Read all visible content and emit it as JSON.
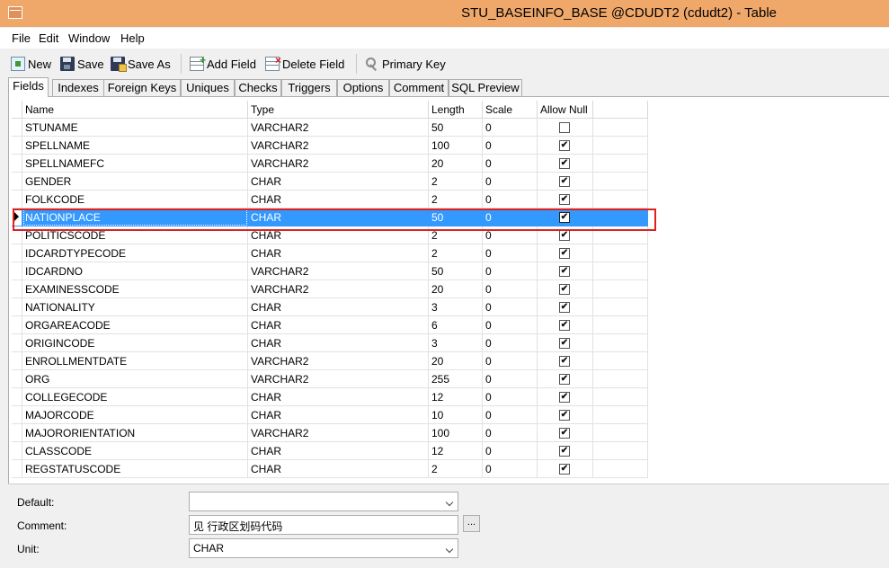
{
  "window": {
    "title": "STU_BASEINFO_BASE @CDUDT2 (cdudt2) - Table"
  },
  "menu": [
    "File",
    "Edit",
    "Window",
    "Help"
  ],
  "toolbar": {
    "new_label": "New",
    "save_label": "Save",
    "save_as_label": "Save As",
    "add_field_label": "Add Field",
    "delete_field_label": "Delete Field",
    "primary_key_label": "Primary Key"
  },
  "tabs": [
    "Fields",
    "Indexes",
    "Foreign Keys",
    "Uniques",
    "Checks",
    "Triggers",
    "Options",
    "Comment",
    "SQL Preview"
  ],
  "active_tab": "Fields",
  "grid": {
    "columns": [
      "Name",
      "Type",
      "Length",
      "Scale",
      "Allow Null"
    ],
    "rows": [
      {
        "name": "STUNAME",
        "type": "VARCHAR2",
        "length": "50",
        "scale": "0",
        "allow_null": false
      },
      {
        "name": "SPELLNAME",
        "type": "VARCHAR2",
        "length": "100",
        "scale": "0",
        "allow_null": true
      },
      {
        "name": "SPELLNAMEFC",
        "type": "VARCHAR2",
        "length": "20",
        "scale": "0",
        "allow_null": true
      },
      {
        "name": "GENDER",
        "type": "CHAR",
        "length": "2",
        "scale": "0",
        "allow_null": true
      },
      {
        "name": "FOLKCODE",
        "type": "CHAR",
        "length": "2",
        "scale": "0",
        "allow_null": true
      },
      {
        "name": "NATIONPLACE",
        "type": "CHAR",
        "length": "50",
        "scale": "0",
        "allow_null": true
      },
      {
        "name": "POLITICSCODE",
        "type": "CHAR",
        "length": "2",
        "scale": "0",
        "allow_null": true
      },
      {
        "name": "IDCARDTYPECODE",
        "type": "CHAR",
        "length": "2",
        "scale": "0",
        "allow_null": true
      },
      {
        "name": "IDCARDNO",
        "type": "VARCHAR2",
        "length": "50",
        "scale": "0",
        "allow_null": true
      },
      {
        "name": "EXAMINESSCODE",
        "type": "VARCHAR2",
        "length": "20",
        "scale": "0",
        "allow_null": true
      },
      {
        "name": "NATIONALITY",
        "type": "CHAR",
        "length": "3",
        "scale": "0",
        "allow_null": true
      },
      {
        "name": "ORGAREACODE",
        "type": "CHAR",
        "length": "6",
        "scale": "0",
        "allow_null": true
      },
      {
        "name": "ORIGINCODE",
        "type": "CHAR",
        "length": "3",
        "scale": "0",
        "allow_null": true
      },
      {
        "name": "ENROLLMENTDATE",
        "type": "VARCHAR2",
        "length": "20",
        "scale": "0",
        "allow_null": true
      },
      {
        "name": "ORG",
        "type": "VARCHAR2",
        "length": "255",
        "scale": "0",
        "allow_null": true
      },
      {
        "name": "COLLEGECODE",
        "type": "CHAR",
        "length": "12",
        "scale": "0",
        "allow_null": true
      },
      {
        "name": "MAJORCODE",
        "type": "CHAR",
        "length": "10",
        "scale": "0",
        "allow_null": true
      },
      {
        "name": "MAJORORIENTATION",
        "type": "VARCHAR2",
        "length": "100",
        "scale": "0",
        "allow_null": true
      },
      {
        "name": "CLASSCODE",
        "type": "CHAR",
        "length": "12",
        "scale": "0",
        "allow_null": true
      },
      {
        "name": "REGSTATUSCODE",
        "type": "CHAR",
        "length": "2",
        "scale": "0",
        "allow_null": true
      }
    ],
    "selected_row": "NATIONPLACE",
    "check_mark": "✔"
  },
  "properties": {
    "default_label": "Default:",
    "default_value": "",
    "comment_label": "Comment:",
    "comment_value": "见 行政区划码代码",
    "comment_button": "...",
    "unit_label": "Unit:",
    "unit_value": "CHAR"
  },
  "colors": {
    "titlebar": "#f0a86a",
    "selection": "#3399ff",
    "highlight_box": "#e0201c"
  }
}
